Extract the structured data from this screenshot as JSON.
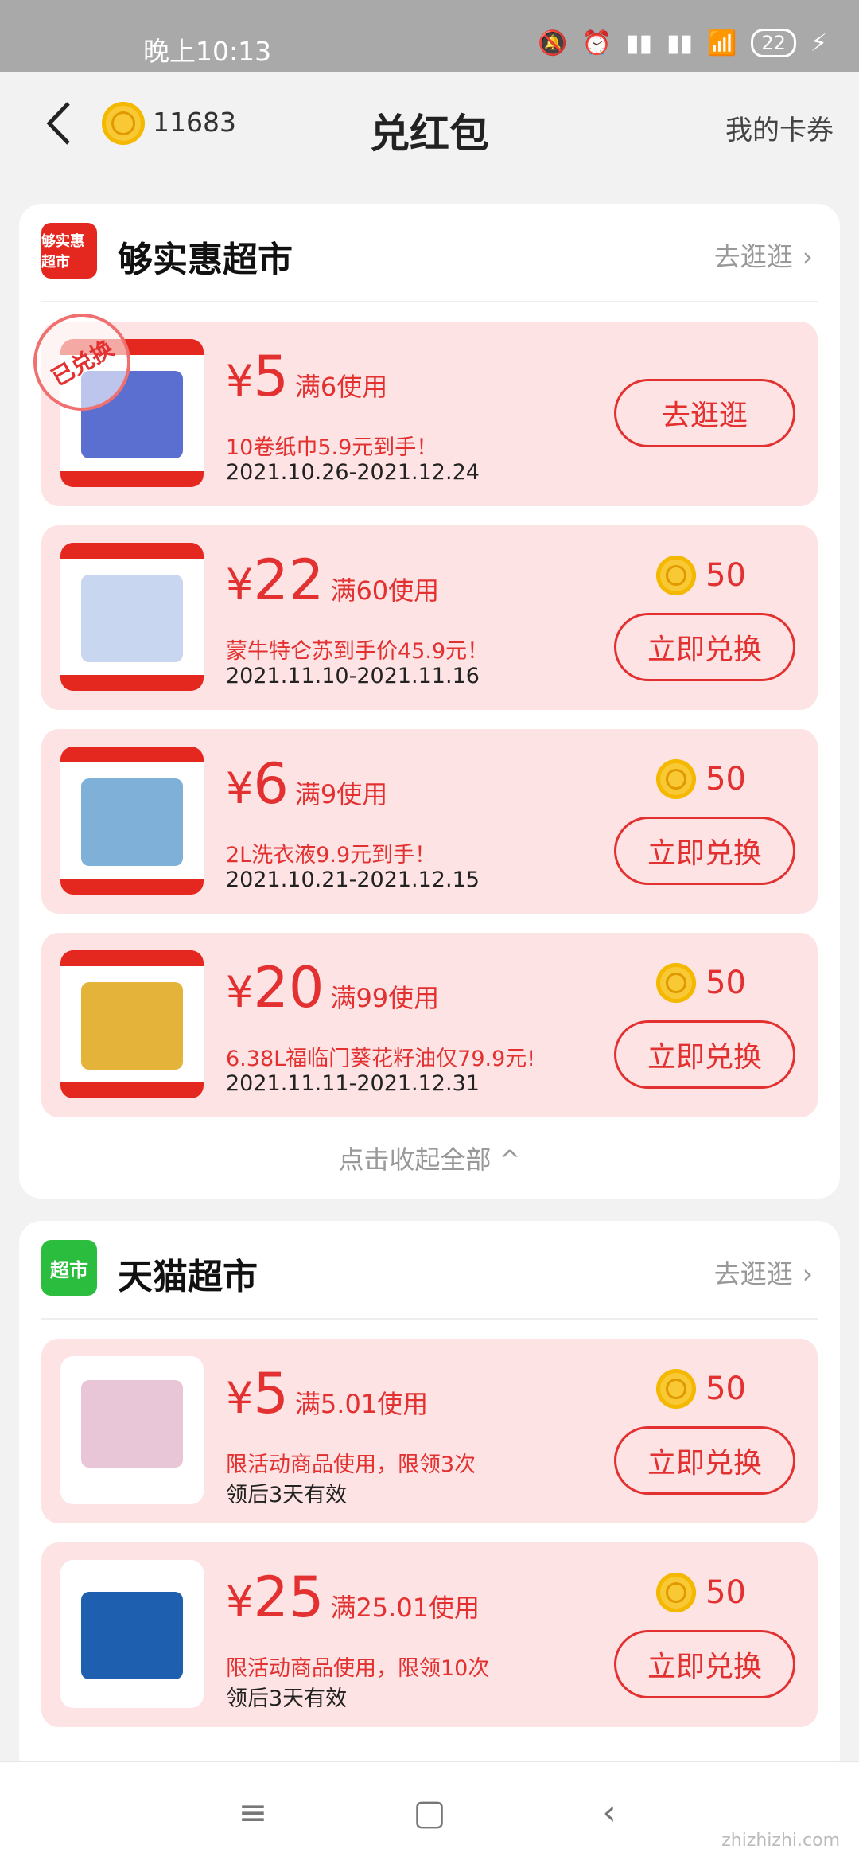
{
  "status_bar": {
    "time": "晚上10:13",
    "battery": "22"
  },
  "header": {
    "coin_count": "11683",
    "title": "兑红包",
    "my_cards": "我的卡券"
  },
  "section1": {
    "logo_text": "够实惠超市",
    "shop_name": "够实惠超市",
    "go_shop": "去逛逛",
    "coupons": [
      {
        "yen": "¥",
        "amount": "5",
        "condition": "满6使用",
        "desc": "10卷纸巾5.9元到手！",
        "date": "2021.10.26-2021.12.24",
        "stamp": "已兑换",
        "button": "去逛逛"
      },
      {
        "yen": "¥",
        "amount": "22",
        "condition": "满60使用",
        "desc": "蒙牛特仑苏到手价45.9元！",
        "date": "2021.11.10-2021.11.16",
        "cost": "50",
        "button": "立即兑换"
      },
      {
        "yen": "¥",
        "amount": "6",
        "condition": "满9使用",
        "desc": "2L洗衣液9.9元到手！",
        "date": "2021.10.21-2021.12.15",
        "cost": "50",
        "button": "立即兑换"
      },
      {
        "yen": "¥",
        "amount": "20",
        "condition": "满99使用",
        "desc": "6.38L福临门葵花籽油仅79.9元!",
        "date": "2021.11.11-2021.12.31",
        "cost": "50",
        "button": "立即兑换"
      }
    ],
    "collapse": "点击收起全部 ^"
  },
  "section2": {
    "logo_text": "超市",
    "shop_name": "天猫超市",
    "go_shop": "去逛逛",
    "coupons": [
      {
        "yen": "¥",
        "amount": "5",
        "condition": "满5.01使用",
        "desc": "限活动商品使用，限领3次",
        "date": "领后3天有效",
        "cost": "50",
        "button": "立即兑换"
      },
      {
        "yen": "¥",
        "amount": "25",
        "condition": "满25.01使用",
        "desc": "限活动商品使用，限领10次",
        "date": "领后3天有效",
        "cost": "50",
        "button": "立即兑换"
      }
    ]
  },
  "watermark": "zhizhizhi.com",
  "colors": {
    "accent": "#e33030",
    "coupon_bg": "#fde3e3",
    "coin": "#f8c935"
  }
}
